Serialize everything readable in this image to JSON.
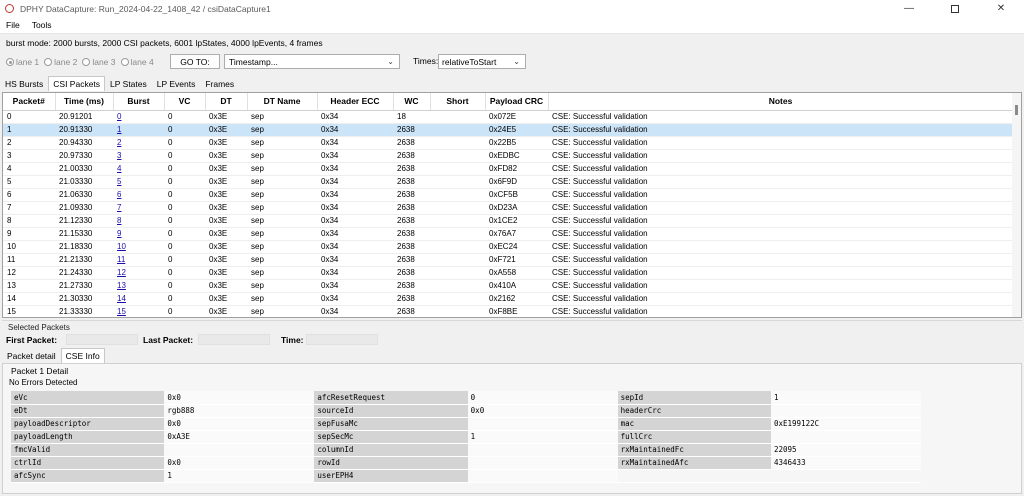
{
  "window": {
    "title": "DPHY DataCapture: Run_2024-04-22_1408_42 / csiDataCapture1"
  },
  "menu": [
    "File",
    "Tools"
  ],
  "summary": "burst mode: 2000 bursts, 2000 CSI packets, 6001 lpStates, 4000 lpEvents, 4 frames",
  "lanes": [
    "lane 1",
    "lane 2",
    "lane 3",
    "lane 4"
  ],
  "goto_label": "GO TO:",
  "goto_select": "Timestamp...",
  "times_label": "Times:",
  "times_select": "relativeToStart",
  "tabs": [
    "HS Bursts",
    "CSI Packets",
    "LP States",
    "LP Events",
    "Frames"
  ],
  "columns": [
    "Packet#",
    "Time (ms)",
    "Burst",
    "VC",
    "DT",
    "DT Name",
    "Header ECC",
    "WC",
    "Short",
    "Payload CRC",
    "Notes"
  ],
  "rows": [
    [
      "0",
      "20.91201",
      "0",
      "0",
      "0x3E",
      "sep",
      "0x34",
      "18",
      "",
      "0x072E",
      "CSE: Successful validation"
    ],
    [
      "1",
      "20.91330",
      "1",
      "0",
      "0x3E",
      "sep",
      "0x34",
      "2638",
      "",
      "0x24E5",
      "CSE: Successful validation"
    ],
    [
      "2",
      "20.94330",
      "2",
      "0",
      "0x3E",
      "sep",
      "0x34",
      "2638",
      "",
      "0x22B5",
      "CSE: Successful validation"
    ],
    [
      "3",
      "20.97330",
      "3",
      "0",
      "0x3E",
      "sep",
      "0x34",
      "2638",
      "",
      "0xEDBC",
      "CSE: Successful validation"
    ],
    [
      "4",
      "21.00330",
      "4",
      "0",
      "0x3E",
      "sep",
      "0x34",
      "2638",
      "",
      "0xFD82",
      "CSE: Successful validation"
    ],
    [
      "5",
      "21.03330",
      "5",
      "0",
      "0x3E",
      "sep",
      "0x34",
      "2638",
      "",
      "0x6F9D",
      "CSE: Successful validation"
    ],
    [
      "6",
      "21.06330",
      "6",
      "0",
      "0x3E",
      "sep",
      "0x34",
      "2638",
      "",
      "0xCF5B",
      "CSE: Successful validation"
    ],
    [
      "7",
      "21.09330",
      "7",
      "0",
      "0x3E",
      "sep",
      "0x34",
      "2638",
      "",
      "0xD23A",
      "CSE: Successful validation"
    ],
    [
      "8",
      "21.12330",
      "8",
      "0",
      "0x3E",
      "sep",
      "0x34",
      "2638",
      "",
      "0x1CE2",
      "CSE: Successful validation"
    ],
    [
      "9",
      "21.15330",
      "9",
      "0",
      "0x3E",
      "sep",
      "0x34",
      "2638",
      "",
      "0x76A7",
      "CSE: Successful validation"
    ],
    [
      "10",
      "21.18330",
      "10",
      "0",
      "0x3E",
      "sep",
      "0x34",
      "2638",
      "",
      "0xEC24",
      "CSE: Successful validation"
    ],
    [
      "11",
      "21.21330",
      "11",
      "0",
      "0x3E",
      "sep",
      "0x34",
      "2638",
      "",
      "0xF721",
      "CSE: Successful validation"
    ],
    [
      "12",
      "21.24330",
      "12",
      "0",
      "0x3E",
      "sep",
      "0x34",
      "2638",
      "",
      "0xA558",
      "CSE: Successful validation"
    ],
    [
      "13",
      "21.27330",
      "13",
      "0",
      "0x3E",
      "sep",
      "0x34",
      "2638",
      "",
      "0x410A",
      "CSE: Successful validation"
    ],
    [
      "14",
      "21.30330",
      "14",
      "0",
      "0x3E",
      "sep",
      "0x34",
      "2638",
      "",
      "0x2162",
      "CSE: Successful validation"
    ],
    [
      "15",
      "21.33330",
      "15",
      "0",
      "0x3E",
      "sep",
      "0x34",
      "2638",
      "",
      "0xF8BE",
      "CSE: Successful validation"
    ]
  ],
  "selected_row_index": 1,
  "selected_packets": {
    "caption": "Selected Packets",
    "first_label": "First Packet:",
    "last_label": "Last Packet:",
    "time_label": "Time:"
  },
  "detail_tabs": [
    "Packet detail",
    "CSE Info"
  ],
  "detail": {
    "caption": "Packet 1 Detail",
    "status": "No Errors Detected",
    "rows": [
      [
        "eVc",
        "0x0",
        "afcResetRequest",
        "0",
        "sepId",
        "1"
      ],
      [
        "eDt",
        "rgb888",
        "sourceId",
        "0x0",
        "headerCrc",
        ""
      ],
      [
        "payloadDescriptor",
        "0x0",
        "sepFusaMc",
        "",
        "mac",
        "0xE199122C"
      ],
      [
        "payloadLength",
        "0xA3E",
        "sepSecMc",
        "1",
        "fullCrc",
        ""
      ],
      [
        "fmcValid",
        "",
        "columnId",
        "",
        "rxMaintainedFc",
        "22095"
      ],
      [
        "ctrlId",
        "0x0",
        "rowId",
        "",
        "rxMaintainedAfc",
        "4346433"
      ],
      [
        "afcSync",
        "1",
        "userEPH4",
        "",
        "",
        ""
      ]
    ]
  },
  "colors": {
    "selection": "#cce4f7",
    "link": "#1a0dab"
  }
}
